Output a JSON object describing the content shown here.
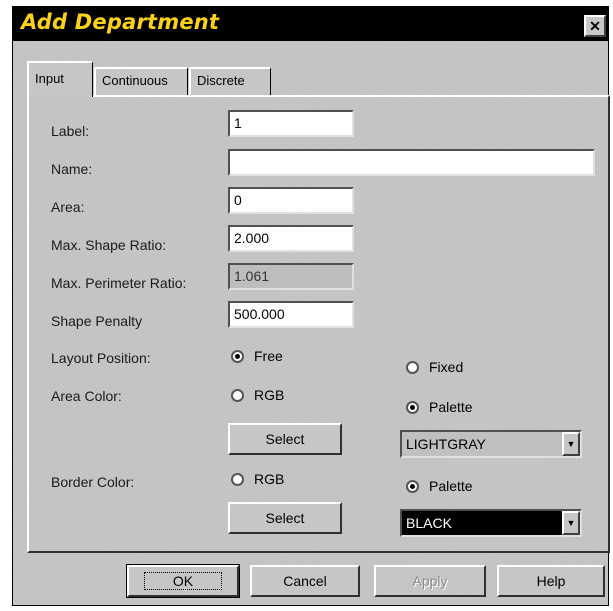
{
  "dialog": {
    "title": "Add Department",
    "close_glyph": "✕"
  },
  "tabs": [
    {
      "label": "Input",
      "active": true
    },
    {
      "label": "Continuous",
      "active": false
    },
    {
      "label": "Discrete",
      "active": false
    }
  ],
  "form": {
    "label": {
      "label": "Label:",
      "value": "1"
    },
    "name": {
      "label": "Name:",
      "value": ""
    },
    "area": {
      "label": "Area:",
      "value": "0"
    },
    "max_shape_ratio": {
      "label": "Max. Shape Ratio:",
      "value": "2.000"
    },
    "max_perimeter_ratio": {
      "label": "Max. Perimeter Ratio:",
      "value": "1.061"
    },
    "shape_penalty": {
      "label": "Shape Penalty",
      "value": "500.000"
    },
    "layout_position": {
      "label": "Layout Position:",
      "free": "Free",
      "fixed": "Fixed",
      "selected": "Free"
    },
    "area_color": {
      "label": "Area Color:",
      "rgb": "RGB",
      "palette": "Palette",
      "selected": "Palette",
      "select_button": "Select",
      "palette_value": "LIGHTGRAY",
      "swatch_bg": "#c0c0c0",
      "swatch_fg": "#000000"
    },
    "border_color": {
      "label": "Border Color:",
      "rgb": "RGB",
      "palette": "Palette",
      "selected": "Palette",
      "select_button": "Select",
      "palette_value": "BLACK",
      "swatch_bg": "#000000",
      "swatch_fg": "#ffffff"
    }
  },
  "footer": {
    "ok": "OK",
    "cancel": "Cancel",
    "apply": "Apply",
    "help": "Help"
  },
  "icons": {
    "dropdown": "chevron-down-icon",
    "radio": "radio-icon",
    "close": "close-icon"
  }
}
